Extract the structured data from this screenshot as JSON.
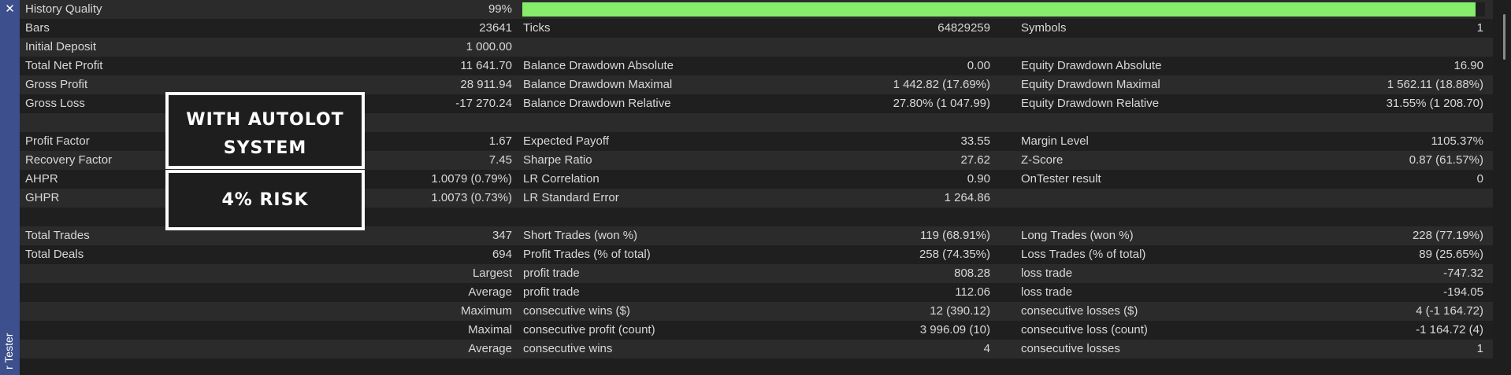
{
  "sidebar": {
    "close_label": "✕",
    "vertical_label": "r Tester"
  },
  "quality": {
    "percent": 99,
    "fill_color": "#86ec6c"
  },
  "overlay": {
    "box1_line1": "WITH AUTOLOT",
    "box1_line2": "SYSTEM",
    "box2": "4% RISK"
  },
  "rows": [
    {
      "c1": "History Quality",
      "v1": "99%",
      "c2": "",
      "v2": "",
      "c3": "",
      "v3": ""
    },
    {
      "c1": "Bars",
      "v1": "23641",
      "c2": "Ticks",
      "v2": "64829259",
      "c3": "Symbols",
      "v3": "1"
    },
    {
      "c1": "Initial Deposit",
      "v1": "1 000.00",
      "c2": "",
      "v2": "",
      "c3": "",
      "v3": ""
    },
    {
      "c1": "Total Net Profit",
      "v1": "11 641.70",
      "c2": "Balance Drawdown Absolute",
      "v2": "0.00",
      "c3": "Equity Drawdown Absolute",
      "v3": "16.90"
    },
    {
      "c1": "Gross Profit",
      "v1": "28 911.94",
      "c2": "Balance Drawdown Maximal",
      "v2": "1 442.82 (17.69%)",
      "c3": "Equity Drawdown Maximal",
      "v3": "1 562.11 (18.88%)"
    },
    {
      "c1": "Gross Loss",
      "v1": "-17 270.24",
      "c2": "Balance Drawdown Relative",
      "v2": "27.80% (1 047.99)",
      "c3": "Equity Drawdown Relative",
      "v3": "31.55% (1 208.70)"
    },
    {
      "c1": "",
      "v1": "",
      "c2": "",
      "v2": "",
      "c3": "",
      "v3": ""
    },
    {
      "c1": "Profit Factor",
      "v1": "1.67",
      "c2": "Expected Payoff",
      "v2": "33.55",
      "c3": "Margin Level",
      "v3": "1105.37%"
    },
    {
      "c1": "Recovery Factor",
      "v1": "7.45",
      "c2": "Sharpe Ratio",
      "v2": "27.62",
      "c3": "Z-Score",
      "v3": "0.87 (61.57%)"
    },
    {
      "c1": "AHPR",
      "v1": "1.0079 (0.79%)",
      "c2": "LR Correlation",
      "v2": "0.90",
      "c3": "OnTester result",
      "v3": "0"
    },
    {
      "c1": "GHPR",
      "v1": "1.0073 (0.73%)",
      "c2": "LR Standard Error",
      "v2": "1 264.86",
      "c3": "",
      "v3": ""
    },
    {
      "c1": "",
      "v1": "",
      "c2": "",
      "v2": "",
      "c3": "",
      "v3": ""
    },
    {
      "c1": "Total Trades",
      "v1": "347",
      "c2": "Short Trades (won %)",
      "v2": "119 (68.91%)",
      "c3": "Long Trades (won %)",
      "v3": "228 (77.19%)"
    },
    {
      "c1": "Total Deals",
      "v1": "694",
      "c2": "Profit Trades (% of total)",
      "v2": "258 (74.35%)",
      "c3": "Loss Trades (% of total)",
      "v3": "89 (25.65%)"
    },
    {
      "c1": "",
      "v1": "Largest",
      "c2": "profit trade",
      "v2": "808.28",
      "c3": "loss trade",
      "v3": "-747.32"
    },
    {
      "c1": "",
      "v1": "Average",
      "c2": "profit trade",
      "v2": "112.06",
      "c3": "loss trade",
      "v3": "-194.05"
    },
    {
      "c1": "",
      "v1": "Maximum",
      "c2": "consecutive wins ($)",
      "v2": "12 (390.12)",
      "c3": "consecutive losses ($)",
      "v3": "4 (-1 164.72)"
    },
    {
      "c1": "",
      "v1": "Maximal",
      "c2": "consecutive profit (count)",
      "v2": "3 996.09 (10)",
      "c3": "consecutive loss (count)",
      "v3": "-1 164.72 (4)"
    },
    {
      "c1": "",
      "v1": "Average",
      "c2": "consecutive wins",
      "v2": "4",
      "c3": "consecutive losses",
      "v3": "1"
    }
  ]
}
